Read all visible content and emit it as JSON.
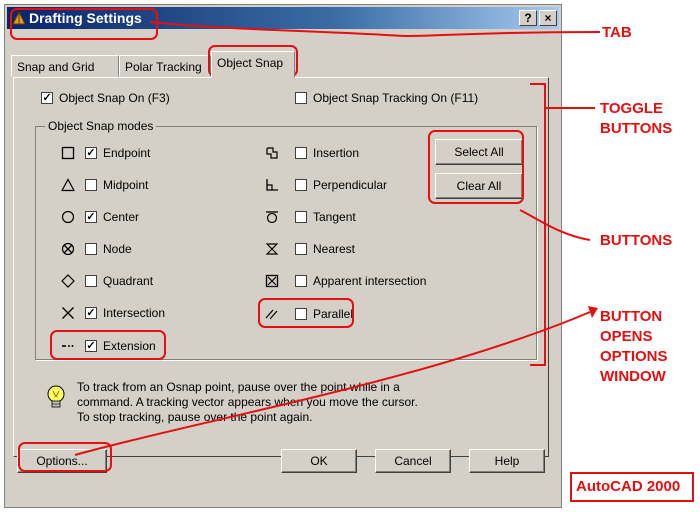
{
  "window": {
    "title": "Drafting Settings",
    "help_glyph": "?",
    "close_glyph": "×"
  },
  "tabs": [
    {
      "label": "Snap and Grid"
    },
    {
      "label": "Polar Tracking"
    },
    {
      "label": "Object Snap",
      "selected": true
    }
  ],
  "toggles": {
    "snap_on": {
      "label": "Object Snap On (F3)",
      "checked": true
    },
    "tracking_on": {
      "label": "Object Snap Tracking On (F11)",
      "checked": false
    }
  },
  "modes_group_label": "Object Snap modes",
  "modes_left": [
    {
      "label": "Endpoint",
      "checked": true,
      "icon": "square"
    },
    {
      "label": "Midpoint",
      "checked": false,
      "icon": "triangle"
    },
    {
      "label": "Center",
      "checked": true,
      "icon": "circle"
    },
    {
      "label": "Node",
      "checked": false,
      "icon": "circle-x"
    },
    {
      "label": "Quadrant",
      "checked": false,
      "icon": "diamond"
    },
    {
      "label": "Intersection",
      "checked": true,
      "icon": "x"
    },
    {
      "label": "Extension",
      "checked": true,
      "icon": "dash-dot"
    }
  ],
  "modes_right": [
    {
      "label": "Insertion",
      "checked": false,
      "icon": "insertion"
    },
    {
      "label": "Perpendicular",
      "checked": false,
      "icon": "perpendicular"
    },
    {
      "label": "Tangent",
      "checked": false,
      "icon": "tangent"
    },
    {
      "label": "Nearest",
      "checked": false,
      "icon": "hourglass"
    },
    {
      "label": "Apparent intersection",
      "checked": false,
      "icon": "box-x"
    },
    {
      "label": "Parallel",
      "checked": false,
      "icon": "parallel"
    }
  ],
  "buttons": {
    "select_all": "Select All",
    "clear_all": "Clear All",
    "options": "Options...",
    "ok": "OK",
    "cancel": "Cancel",
    "help": "Help"
  },
  "tip": {
    "line1": "To track from an Osnap point, pause over the point while in a",
    "line2": "command.  A tracking vector appears when you move the cursor.",
    "line3": "To stop tracking, pause over the point again."
  },
  "annotations": {
    "tab": "TAB",
    "toggle1": "TOGGLE",
    "toggle2": "BUTTONS",
    "buttons": "BUTTONS",
    "opens1": "BUTTON",
    "opens2": "OPENS",
    "opens3": "OPTIONS",
    "opens4": "WINDOW",
    "brand": "AutoCAD 2000"
  },
  "colors": {
    "annotation": "#e41010",
    "dialog_face": "#d4d0c8",
    "title_bar": "#0a246a"
  }
}
